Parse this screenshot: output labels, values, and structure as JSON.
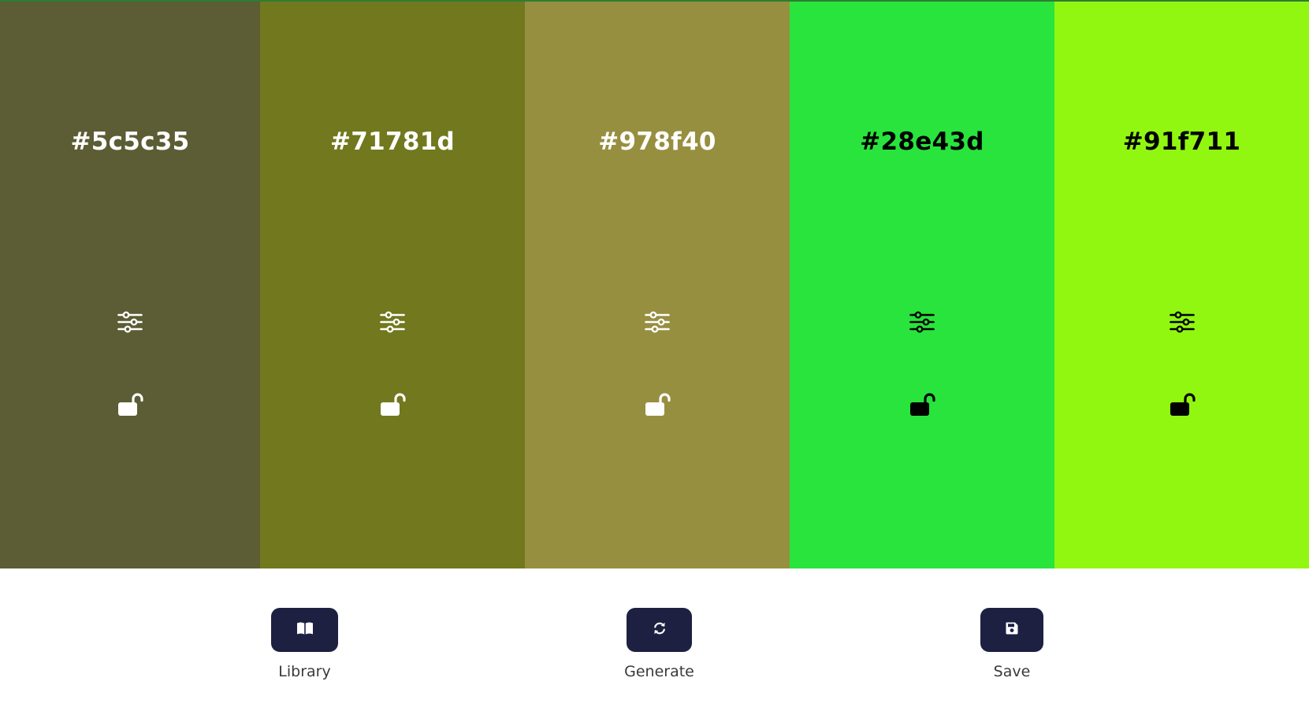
{
  "palette": {
    "swatches": [
      {
        "hex": "#5c5c35",
        "color": "#5c5c35",
        "text_color": "#ffffff",
        "adjust_icon": "sliders-icon",
        "lock_icon": "unlocked-padlock-icon",
        "locked": false
      },
      {
        "hex": "#71781d",
        "color": "#71781d",
        "text_color": "#ffffff",
        "adjust_icon": "sliders-icon",
        "lock_icon": "unlocked-padlock-icon",
        "locked": false
      },
      {
        "hex": "#978f40",
        "color": "#978f40",
        "text_color": "#ffffff",
        "adjust_icon": "sliders-icon",
        "lock_icon": "unlocked-padlock-icon",
        "locked": false
      },
      {
        "hex": "#28e43d",
        "color": "#28e43d",
        "text_color": "#000000",
        "adjust_icon": "sliders-icon",
        "lock_icon": "unlocked-padlock-icon",
        "locked": false
      },
      {
        "hex": "#91f711",
        "color": "#91f711",
        "text_color": "#000000",
        "adjust_icon": "sliders-icon",
        "lock_icon": "unlocked-padlock-icon",
        "locked": false
      }
    ]
  },
  "controls": {
    "library": {
      "label": "Library",
      "icon": "book-open-icon"
    },
    "generate": {
      "label": "Generate",
      "icon": "refresh-icon"
    },
    "save": {
      "label": "Save",
      "icon": "floppy-disk-icon"
    }
  },
  "colors": {
    "button_bg": "#1e2042",
    "label_text": "#3a3a3a",
    "top_border": "#2e7d32"
  }
}
